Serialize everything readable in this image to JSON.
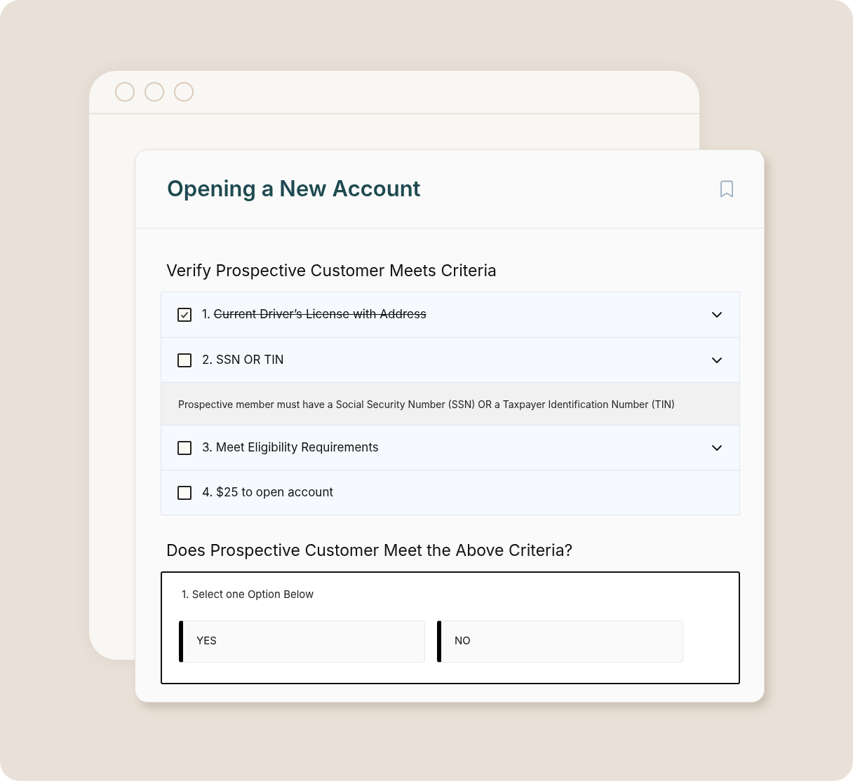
{
  "card": {
    "title": "Opening a New Account"
  },
  "criteria": {
    "heading": "Verify Prospective Customer Meets Criteria",
    "items": [
      {
        "kind": "expandable",
        "number": "1.",
        "label": "Current Driver’s License with Address",
        "checked": true
      },
      {
        "kind": "expandable",
        "number": "2.",
        "label": "SSN OR TIN",
        "checked": false,
        "details": "Prospective member must have a Social Security Number (SSN) OR a Taxpayer Identification Number (TIN)"
      },
      {
        "kind": "expandable",
        "number": "3.",
        "label": "Meet Eligibility Requirements",
        "checked": false
      },
      {
        "kind": "plain",
        "number": "4.",
        "label": "$25 to open account",
        "checked": false
      }
    ]
  },
  "question": {
    "heading": "Does Prospective Customer Meet the Above Criteria?",
    "prompt": "1. Select one Option Below",
    "options": [
      "YES",
      "NO"
    ]
  }
}
